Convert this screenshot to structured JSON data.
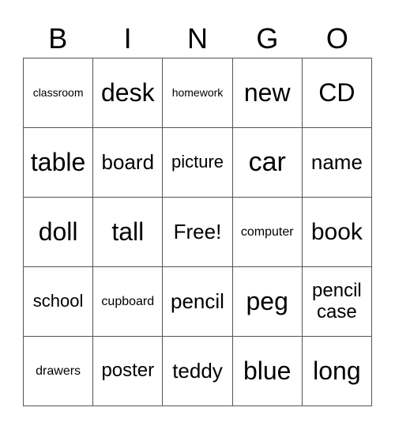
{
  "header": [
    "B",
    "I",
    "N",
    "G",
    "O"
  ],
  "cells": [
    [
      "classroom",
      "desk",
      "homework",
      "new",
      "CD"
    ],
    [
      "table",
      "board",
      "picture",
      "car",
      "name"
    ],
    [
      "doll",
      "tall",
      "Free!",
      "computer",
      "book"
    ],
    [
      "school",
      "cupboard",
      "pencil",
      "peg",
      "pencil case"
    ],
    [
      "drawers",
      "poster",
      "teddy",
      "blue",
      "long"
    ]
  ]
}
